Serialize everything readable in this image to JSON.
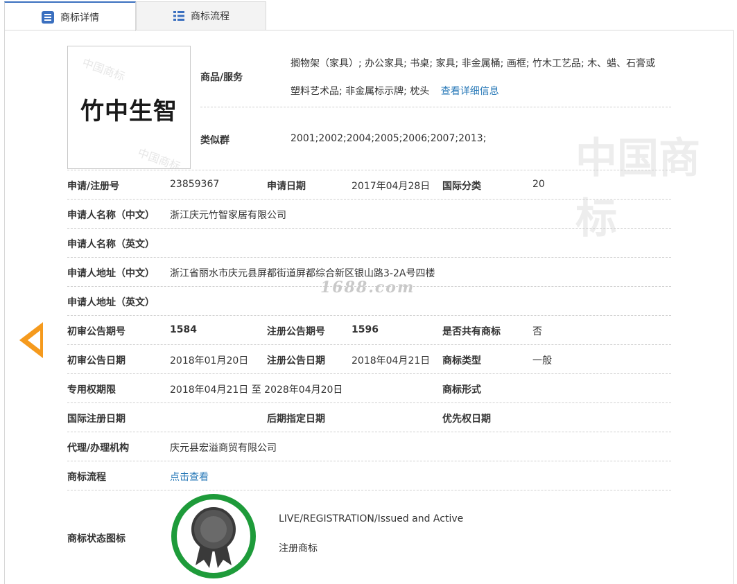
{
  "tabs": [
    {
      "label": "商标详情",
      "icon": "document-list-icon",
      "active": true
    },
    {
      "label": "商标流程",
      "icon": "list-icon",
      "active": false
    }
  ],
  "logo": {
    "text": "竹中生智",
    "watermark": "中国商标"
  },
  "goods": {
    "label": "商品/服务",
    "line1": "搁物架（家具）; 办公家具; 书桌; 家具; 非金属桶; 画框; 竹木工艺品; 木、蜡、石膏或",
    "line2": "塑料艺术品; 非金属标示牌; 枕头",
    "detail_link": "查看详细信息"
  },
  "similar_group": {
    "label": "类似群",
    "value": "2001;2002;2004;2005;2006;2007;2013;"
  },
  "fields": {
    "reg_no_label": "申请/注册号",
    "reg_no": "23859367",
    "app_date_label": "申请日期",
    "app_date": "2017年04月28日",
    "intl_class_label": "国际分类",
    "intl_class": "20",
    "applicant_cn_label": "申请人名称（中文）",
    "applicant_cn": "浙江庆元竹智家居有限公司",
    "applicant_en_label": "申请人名称（英文）",
    "applicant_en": "",
    "address_cn_label": "申请人地址（中文）",
    "address_cn": "浙江省丽水市庆元县屏都街道屏都综合新区银山路3-2A号四楼",
    "address_en_label": "申请人地址（英文）",
    "address_en": "",
    "prelim_no_label": "初审公告期号",
    "prelim_no": "1584",
    "reg_pub_no_label": "注册公告期号",
    "reg_pub_no": "1596",
    "shared_label": "是否共有商标",
    "shared": "否",
    "prelim_date_label": "初审公告日期",
    "prelim_date": "2018年01月20日",
    "reg_pub_date_label": "注册公告日期",
    "reg_pub_date": "2018年04月21日",
    "type_label": "商标类型",
    "type": "一般",
    "exclusive_label": "专用权期限",
    "exclusive": "2018年04月21日 至 2028年04月20日",
    "form_label": "商标形式",
    "form": "",
    "intl_reg_date_label": "国际注册日期",
    "intl_reg_date": "",
    "later_date_label": "后期指定日期",
    "later_date": "",
    "priority_label": "优先权日期",
    "priority": "",
    "agent_label": "代理/办理机构",
    "agent": "庆元县宏溢商贸有限公司",
    "process_label": "商标流程",
    "process_link": "点击查看",
    "status_icon_label": "商标状态图标"
  },
  "status": {
    "line1": "LIVE/REGISTRATION/Issued and Active",
    "line2": "注册商标",
    "icon": "award-ribbon-icon"
  },
  "site_watermark": "1688.com",
  "colors": {
    "accent": "#3a6fbf",
    "link": "#2a7ab8",
    "arrow": "#f59a1d",
    "status_ring": "#1e9b3a"
  }
}
